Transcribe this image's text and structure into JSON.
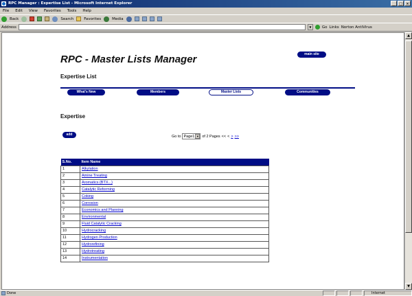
{
  "window": {
    "title": "RPC Manager : Expertise List - Microsoft Internet Explorer"
  },
  "menubar": [
    "File",
    "Edit",
    "View",
    "Favorites",
    "Tools",
    "Help"
  ],
  "toolbar": {
    "back": "Back",
    "search": "Search",
    "favorites": "Favorites",
    "media": "Media"
  },
  "addressbar": {
    "label": "Address",
    "value": "",
    "go": "Go",
    "links": "Links",
    "norton": "Norton AntiVirus"
  },
  "status": {
    "left": "Done",
    "zone": "Internet"
  },
  "page": {
    "title": "RPC - Master Lists Manager",
    "main_site": "main site",
    "subtitle": "Expertise List",
    "nav": [
      "What's New",
      "Members",
      "Master Lists",
      "Communities"
    ],
    "active_nav": "Master Lists",
    "section": "Expertise",
    "add_label": "add",
    "pager": {
      "goto": "Go to",
      "selected_page": "Page1",
      "of_pages": "of 2 Pages",
      "first": "<<",
      "prev": "<",
      "next": ">",
      "last": ">>"
    },
    "table": {
      "columns": [
        "S.No.",
        "Item Name"
      ],
      "rows": [
        {
          "sno": "1",
          "name": "Alkylation"
        },
        {
          "sno": "2",
          "name": "Amine Treating"
        },
        {
          "sno": "3",
          "name": "Aromatics (BTX...)"
        },
        {
          "sno": "4",
          "name": "Catalytic Reforming"
        },
        {
          "sno": "5",
          "name": "Coking"
        },
        {
          "sno": "6",
          "name": "Corrosion"
        },
        {
          "sno": "7",
          "name": "Economics and Planning"
        },
        {
          "sno": "8",
          "name": "Environmental"
        },
        {
          "sno": "9",
          "name": "Fluid Catalytic Cracking"
        },
        {
          "sno": "10",
          "name": "Hydrocracking"
        },
        {
          "sno": "11",
          "name": "Hydrogen Production"
        },
        {
          "sno": "12",
          "name": "Hydrorefining"
        },
        {
          "sno": "13",
          "name": "Hydrotreating"
        },
        {
          "sno": "14",
          "name": "Instrumentation"
        }
      ]
    }
  },
  "colors": {
    "accent": "#000d85",
    "link": "#0000cc",
    "titlebar": "#0a246a"
  }
}
